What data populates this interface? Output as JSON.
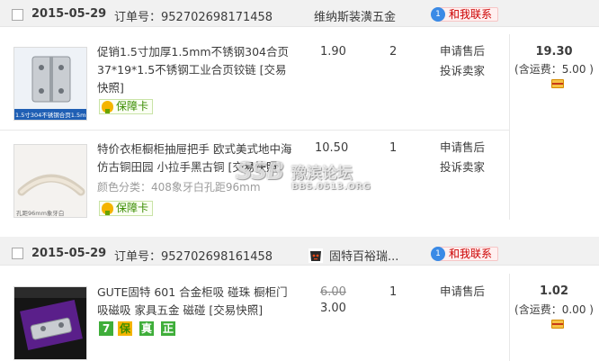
{
  "orders": [
    {
      "date": "2015-05-29",
      "order_label": "订单号：",
      "order_number": "952702698171458",
      "shop": "维纳斯装潢五金",
      "contact": "和我联系",
      "total": "19.30",
      "shipping": "(含运费：5.00 )",
      "items": [
        {
          "title": "促销1.5寸加厚1.5mm不锈钢304合页 37*19*1.5不锈钢工业合页铰链 [交易快照]",
          "thumb_caption": "1.5寸304不锈钢合页1.5mm厚",
          "price": "1.90",
          "qty": "2",
          "actions": [
            "申请售后",
            "投诉卖家"
          ],
          "guarantee": "保障卡"
        },
        {
          "title": "特价衣柜橱柜抽屉把手 欧式美式地中海仿古铜田园 小拉手黑古铜 [交易快照]",
          "sku": "颜色分类：408象牙白孔距96mm",
          "thumb_caption": "孔距96mm象牙白",
          "price": "10.50",
          "qty": "1",
          "actions": [
            "申请售后",
            "投诉卖家"
          ],
          "guarantee": "保障卡"
        }
      ]
    },
    {
      "date": "2015-05-29",
      "order_label": "订单号：",
      "order_number": "952702698161458",
      "shop": "固特百裕瑞...",
      "contact": "和我联系",
      "total": "1.02",
      "shipping": "(含运费：0.00 )",
      "items": [
        {
          "title": "GUTE固特 601 合金柜吸 碰珠 橱柜门吸磁吸 家具五金 磁碰 [交易快照]",
          "original_price": "6.00",
          "price": "3.00",
          "qty": "1",
          "actions": [
            "申请售后"
          ],
          "badges": [
            "7",
            "保",
            "真",
            "正"
          ]
        }
      ]
    }
  ],
  "watermark": {
    "logo": "SSB",
    "name": "豫滨论坛",
    "url": "BBS.0513.ORG"
  },
  "colors": {
    "header_bg": "#f1f1f1",
    "contact_red": "#cc0000",
    "guarantee_green": "#3a8c00"
  }
}
